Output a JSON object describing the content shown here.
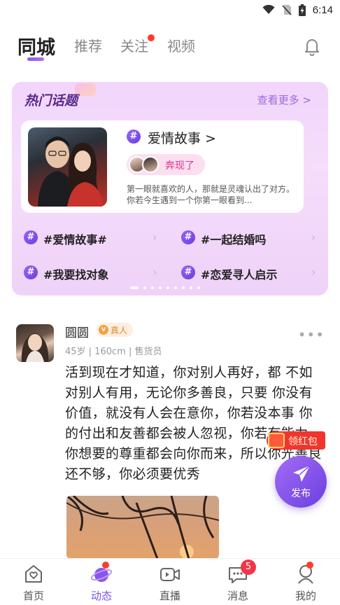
{
  "status_bar": {
    "time": "6:14"
  },
  "top_tabs": [
    {
      "label": "同城",
      "active": true
    },
    {
      "label": "推荐",
      "active": false
    },
    {
      "label": "关注",
      "active": false,
      "has_dot": true
    },
    {
      "label": "视频",
      "active": false
    }
  ],
  "topics": {
    "title": "热门话题",
    "view_more": "查看更多 >",
    "featured": {
      "title": "爱情故事 >",
      "pill": "奔现了",
      "description": "第一眼就喜欢的人，那就是灵魂认出了对方。你若今生遇到一个你第一眼看到..."
    },
    "items": [
      "#爱情故事#",
      "#一起结婚吗",
      "#我要找对象",
      "#恋爱寻人启示"
    ],
    "page_count": 9,
    "active_page": 1
  },
  "post": {
    "name": "圆圆",
    "badge": "真人",
    "meta": "45岁 | 160cm | 售货员",
    "text": "活到现在才知道，你对别人再好，都 不如对别人有用，无论你多善良，只要 你没有价值，就没有人会在意你，你若没本事 你的付出和友善都会被人忽视，你若有能力 你想要的尊重都会向你而来，所以你光善良还不够，你必须要优秀",
    "more": "•••"
  },
  "floating": {
    "red_packet": "领红包",
    "publish": "发布"
  },
  "bottom_nav": [
    {
      "label": "首页",
      "active": false
    },
    {
      "label": "动态",
      "active": true
    },
    {
      "label": "直播",
      "active": false
    },
    {
      "label": "消息",
      "active": false,
      "badge": "5"
    },
    {
      "label": "我的",
      "active": false
    }
  ],
  "colors": {
    "accent": "#7a4cf0",
    "red": "#f0352e"
  }
}
